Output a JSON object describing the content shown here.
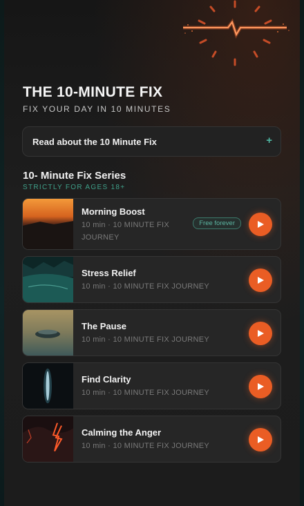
{
  "header": {
    "title": "THE 10-MINUTE FIX",
    "subtitle": "FIX YOUR DAY IN 10 MINUTES"
  },
  "read_card": {
    "label": "Read about the 10 Minute Fix",
    "icon": "plus-icon"
  },
  "series": {
    "title": "10- Minute Fix Series",
    "subtitle": "STRICTLY FOR AGES 18+"
  },
  "colors": {
    "accent_orange": "#ea5d24",
    "accent_teal": "#4fb8a4",
    "background": "#1b1b1b"
  },
  "items": [
    {
      "title": "Morning Boost",
      "meta_line1": "10 min · 10 MINUTE FIX",
      "meta_line2": "JOURNEY",
      "badge": "Free forever"
    },
    {
      "title": "Stress Relief",
      "meta": "10 min · 10 MINUTE FIX JOURNEY"
    },
    {
      "title": "The Pause",
      "meta": "10 min · 10 MINUTE FIX JOURNEY"
    },
    {
      "title": "Find Clarity",
      "meta": "10 min · 10 MINUTE FIX JOURNEY"
    },
    {
      "title": "Calming the Anger",
      "meta": "10 min · 10 MINUTE FIX JOURNEY"
    }
  ]
}
